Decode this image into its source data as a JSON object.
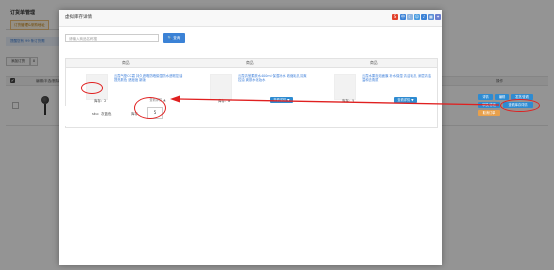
{
  "background": {
    "title": "订货单管理",
    "tab_active": "订货管理&采购地址",
    "notice": "提醒您有 99 条订货需",
    "button1": "添加订货",
    "button2": "X",
    "table_header_left": "编辑/半选/删除",
    "table_header_right": "操作"
  },
  "actions": [
    "详情",
    "编辑",
    "发货/查看",
    "审核/修改",
    "查看库存详情",
    "取消订单"
  ],
  "modal": {
    "title": "虚拟库存详情",
    "search_placeholder": "请输入商品名称搜",
    "search_button": "查询",
    "column_header": "商品",
    "products": [
      {
        "name": "云霞气垫CC霜 持久遮瑕防晒保湿防水遮瑕控油提亮肤色 遮痘痘 新版",
        "stock_label": "库存：",
        "stock_value": "2",
        "more_label": "查看详情 ▲"
      },
      {
        "name": "云霞清莹柔肤水400ml 保湿补水 收缩毛孔清爽控油 爽肤水化妆水",
        "stock_label": "库存：",
        "stock_value": "8",
        "more_label": "查看详情 ▼"
      },
      {
        "name": "云霞水果泡泡面膜 补水保湿 清洁毛孔 深层清洁温和去角质",
        "stock_label": "库存：",
        "stock_value": "5",
        "more_label": "查看详情 ▼"
      }
    ],
    "sku_label": "sku：灰蓝色",
    "sku_stock_label": "库存",
    "sku_stock_value": "5"
  },
  "colors": {
    "accent": "#3b82d6",
    "annotation": "#e02020",
    "action_blue": "#2e8bd1",
    "action_orange": "#e8a04b"
  }
}
